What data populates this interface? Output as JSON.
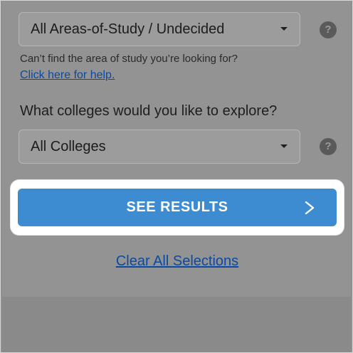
{
  "area_of_study": {
    "selected": "All Areas-of-Study / Undecided",
    "help_icon": "?",
    "hint_text": "Can’t find the area of study you’re looking for?",
    "help_link": "Click here for help."
  },
  "colleges": {
    "question": "What colleges would you like to explore?",
    "selected": "All Colleges",
    "help_icon": "?"
  },
  "actions": {
    "see_results_label": "SEE RESULTS",
    "see_results_icon": "chevron-right-icon",
    "clear_label": "Clear All Selections"
  },
  "colors": {
    "accent": "#3d8bd0",
    "link": "#0b4aa0",
    "overlay": "#939393"
  }
}
